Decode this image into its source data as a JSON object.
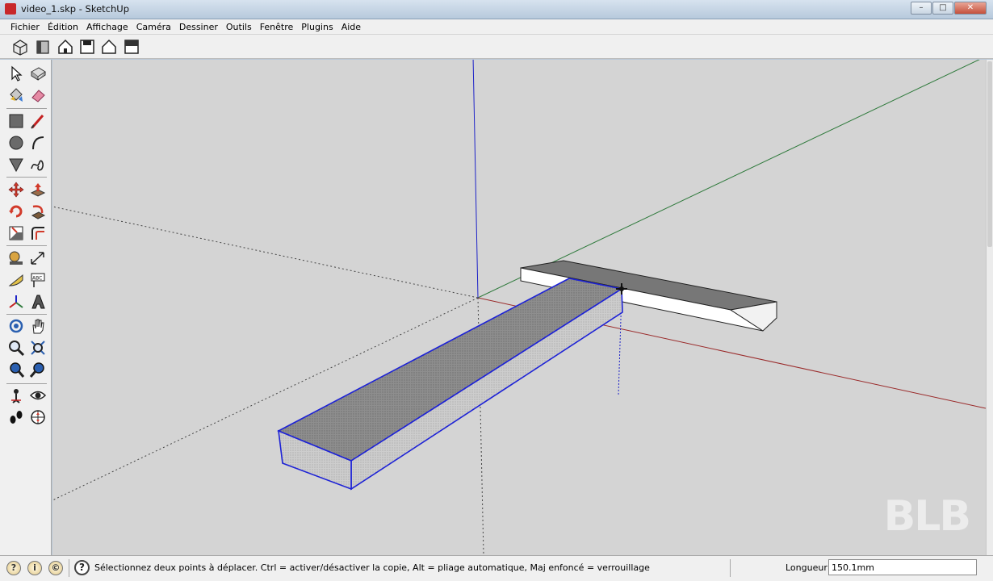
{
  "window": {
    "title": "video_1.skp - SketchUp",
    "buttons": [
      "minimize",
      "maximize",
      "close"
    ]
  },
  "menubar": {
    "items": [
      "Fichier",
      "Édition",
      "Affichage",
      "Caméra",
      "Dessiner",
      "Outils",
      "Fenêtre",
      "Plugins",
      "Aide"
    ]
  },
  "top_toolbar": {
    "icons": [
      "iso-view-icon",
      "front-view-icon",
      "home-view-icon",
      "side-view-icon",
      "back-view-icon",
      "top-view-icon"
    ]
  },
  "left_toolbar": {
    "groups": [
      [
        "select-icon",
        "make-component-icon",
        "paint-bucket-icon",
        "eraser-icon"
      ],
      [
        "rectangle-icon",
        "line-icon",
        "circle-icon",
        "arc-icon",
        "polygon-icon",
        "freehand-icon"
      ],
      [
        "move-icon",
        "push-pull-icon",
        "rotate-icon",
        "follow-me-icon",
        "scale-icon",
        "offset-icon"
      ],
      [
        "tape-measure-icon",
        "dimension-icon",
        "protractor-icon",
        "text-icon",
        "axes-icon",
        "3d-text-icon"
      ],
      [
        "orbit-icon",
        "pan-icon",
        "zoom-icon",
        "zoom-window-icon",
        "zoom-extents-icon",
        "previous-view-icon"
      ],
      [
        "position-camera-icon",
        "look-around-icon",
        "walk-icon",
        "section-plane-icon"
      ]
    ]
  },
  "viewport": {
    "watermark": "BLB",
    "colors": {
      "background": "#d4d4d4",
      "red_axis": "#9a2a2a",
      "green_axis": "#2f7a3c",
      "blue_axis": "#1e23c8",
      "selection": "#1d22d6",
      "top_face": "#8a8a8a",
      "side_face": "#c8c8c8"
    }
  },
  "statusbar": {
    "icons": [
      "geo-location-icon",
      "credits-icon",
      "sign-in-icon",
      "help-icon"
    ],
    "status_labels": [
      "?",
      "i",
      "©"
    ],
    "help_glyph": "?",
    "message": "Sélectionnez deux points à déplacer.  Ctrl = activer/désactiver la copie, Alt = pliage automatique, Maj enfoncé = verrouillage",
    "measure_label": "Longueur",
    "measure_value": "150.1mm"
  }
}
